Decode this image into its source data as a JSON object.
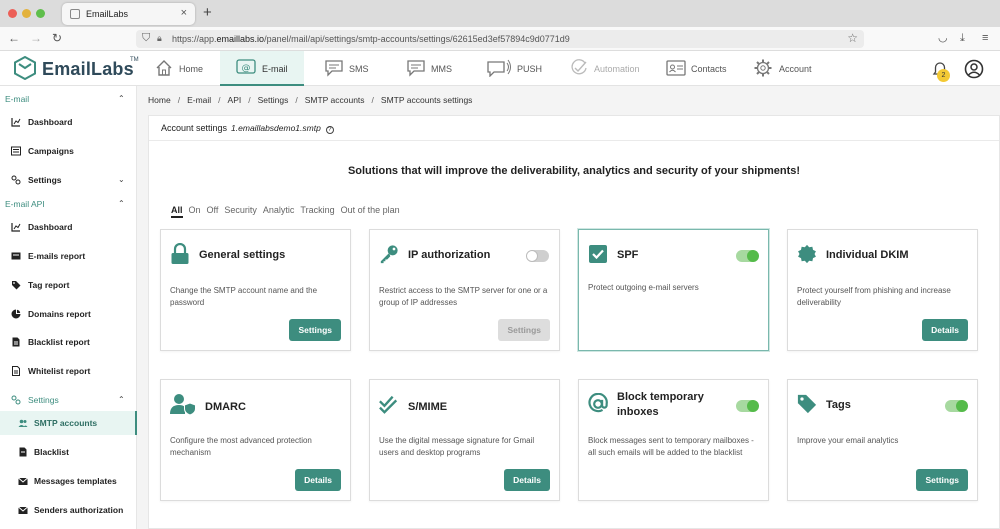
{
  "browser": {
    "tab_title": "EmailLabs",
    "url_prefix": "https://app.",
    "url_host": "emaillabs.io",
    "url_path": "/panel/mail/api/settings/smtp-accounts/settings/62615ed3ef57894c9d0771d9"
  },
  "header": {
    "logo_text": "EmailLabs",
    "logo_tm": "TM",
    "nav": [
      {
        "label": "Home",
        "icon": "home-icon"
      },
      {
        "label": "E-mail",
        "icon": "at-icon"
      },
      {
        "label": "SMS",
        "icon": "chat-icon"
      },
      {
        "label": "MMS",
        "icon": "chat-icon"
      },
      {
        "label": "PUSH",
        "icon": "push-icon"
      },
      {
        "label": "Automation",
        "icon": "check-circle-icon"
      },
      {
        "label": "Contacts",
        "icon": "contact-card-icon"
      },
      {
        "label": "Account",
        "icon": "gear-icon"
      }
    ],
    "notification_count": "2"
  },
  "sidebar": {
    "email_section": "E-mail",
    "email_items": [
      "Dashboard",
      "Campaigns",
      "Settings"
    ],
    "api_section": "E-mail API",
    "api_items": [
      "Dashboard",
      "E-mails report",
      "Tag report",
      "Domains report",
      "Blacklist report",
      "Whitelist report",
      "Settings"
    ],
    "settings_items": [
      "SMTP accounts",
      "Blacklist",
      "Messages templates",
      "Senders authorization"
    ]
  },
  "breadcrumb": [
    "Home",
    "E-mail",
    "API",
    "Settings",
    "SMTP accounts",
    "SMTP accounts settings"
  ],
  "panel": {
    "title": "Account settings",
    "account": "1.emaillabsdemo1.smtp",
    "info": "?",
    "headline": "Solutions that will improve the deliverability, analytics and security of your shipments!",
    "filters": [
      "All",
      "On",
      "Off",
      "Security",
      "Analytic",
      "Tracking",
      "Out of the plan"
    ]
  },
  "cards": [
    {
      "title": "General settings",
      "desc": "Change the SMTP account name and the password",
      "button": "Settings",
      "toggle": null,
      "icon": "lock-icon"
    },
    {
      "title": "IP authorization",
      "desc": "Restrict access to the SMTP server for one or a group of IP addresses",
      "button": "Settings",
      "toggle": "off",
      "icon": "key-icon"
    },
    {
      "title": "SPF",
      "desc": "Protect outgoing e-mail servers",
      "button": null,
      "toggle": "on",
      "icon": "checkbox-icon"
    },
    {
      "title": "Individual DKIM",
      "desc": "Protect yourself from phishing and increase deliverability",
      "button": "Details",
      "toggle": null,
      "icon": "seal-icon"
    },
    {
      "title": "DMARC",
      "desc": "Configure the most advanced protection mechanism",
      "button": "Details",
      "toggle": null,
      "icon": "user-shield-icon"
    },
    {
      "title": "S/MIME",
      "desc": "Use the digital message signature for Gmail users and desktop programs",
      "button": "Details",
      "toggle": null,
      "icon": "double-check-icon"
    },
    {
      "title": "Block temporary inboxes",
      "desc": "Block messages sent to temporary mailboxes - all such emails will be added to the blacklist",
      "button": null,
      "toggle": "on",
      "icon": "at-circle-icon"
    },
    {
      "title": "Tags",
      "desc": "Improve your email analytics",
      "button": "Settings",
      "toggle": "on",
      "icon": "tag-icon"
    }
  ],
  "colors": {
    "accent": "#3d8d7f",
    "toggle_on": "#55bb4a",
    "badge": "#f3c934"
  }
}
